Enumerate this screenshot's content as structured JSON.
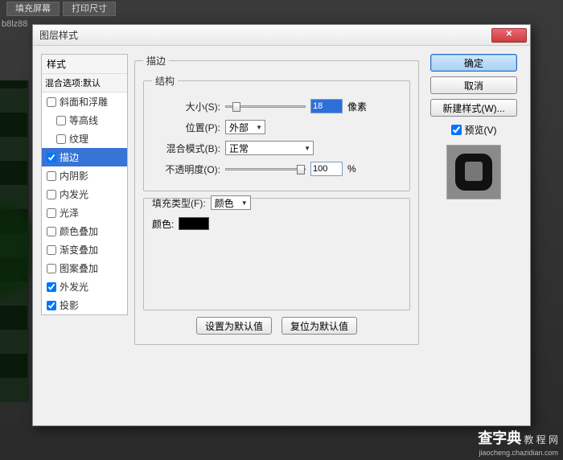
{
  "topbar": {
    "btn1": "填充屏幕",
    "btn2": "打印尺寸"
  },
  "tab": "b8lz88",
  "dialog": {
    "title": "图层样式",
    "close": "✕",
    "styles_header": "样式",
    "blend_header": "混合选项:默认",
    "items": [
      {
        "label": "斜面和浮雕",
        "checked": false,
        "indent": false
      },
      {
        "label": "等高线",
        "checked": false,
        "indent": true
      },
      {
        "label": "纹理",
        "checked": false,
        "indent": true
      },
      {
        "label": "描边",
        "checked": true,
        "indent": false,
        "selected": true
      },
      {
        "label": "内阴影",
        "checked": false,
        "indent": false
      },
      {
        "label": "内发光",
        "checked": false,
        "indent": false
      },
      {
        "label": "光泽",
        "checked": false,
        "indent": false
      },
      {
        "label": "颜色叠加",
        "checked": false,
        "indent": false
      },
      {
        "label": "渐变叠加",
        "checked": false,
        "indent": false
      },
      {
        "label": "图案叠加",
        "checked": false,
        "indent": false
      },
      {
        "label": "外发光",
        "checked": true,
        "indent": false
      },
      {
        "label": "投影",
        "checked": true,
        "indent": false
      }
    ],
    "stroke": {
      "group_title": "描边",
      "struct_title": "结构",
      "size_label": "大小(S):",
      "size_value": "18",
      "size_unit": "像素",
      "pos_label": "位置(P):",
      "pos_value": "外部",
      "blend_label": "混合模式(B):",
      "blend_value": "正常",
      "opacity_label": "不透明度(O):",
      "opacity_value": "100",
      "opacity_unit": "%",
      "filltype_label": "填充类型(F):",
      "filltype_value": "颜色",
      "color_label": "颜色:"
    },
    "buttons": {
      "set_default": "设置为默认值",
      "reset_default": "复位为默认值",
      "ok": "确定",
      "cancel": "取消",
      "new_style": "新建样式(W)...",
      "preview": "预览(V)"
    }
  },
  "watermark": {
    "main": "查字典",
    "sub": "教 程 网",
    "url": "jiaocheng.chazidian.com"
  }
}
